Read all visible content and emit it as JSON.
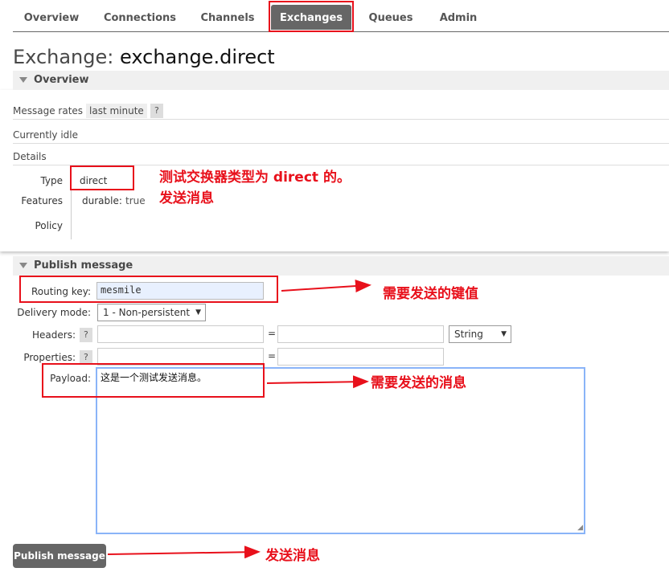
{
  "nav": {
    "items": [
      {
        "label": "Overview",
        "active": false
      },
      {
        "label": "Connections",
        "active": false
      },
      {
        "label": "Channels",
        "active": false
      },
      {
        "label": "Exchanges",
        "active": true
      },
      {
        "label": "Queues",
        "active": false
      },
      {
        "label": "Admin",
        "active": false
      }
    ]
  },
  "title": {
    "prefix": "Exchange:",
    "name": "exchange.direct"
  },
  "overview": {
    "heading": "Overview",
    "rates_label": "Message rates",
    "rates_value": "last minute",
    "help": "?",
    "idle": "Currently idle",
    "details_label": "Details",
    "type_key": "Type",
    "type_value": "direct",
    "features_key": "Features",
    "features_name": "durable:",
    "features_value": "true",
    "policy_key": "Policy"
  },
  "publish": {
    "heading": "Publish message",
    "routing_key_label": "Routing key:",
    "routing_key_value": "mesmile",
    "delivery_mode_label": "Delivery mode:",
    "delivery_mode_value": "1 - Non-persistent",
    "headers_label": "Headers:",
    "properties_label": "Properties:",
    "help": "?",
    "equals": "=",
    "header_type": "String",
    "payload_label": "Payload:",
    "payload_value": "这是一个测试发送消息。",
    "button_label": "Publish message"
  },
  "annotations": {
    "type_note_line1": "测试交换器类型为 direct 的。",
    "type_note_line2": "发送消息",
    "routing_note": "需要发送的键值",
    "payload_note": "需要发送的消息",
    "button_note": "发送消息",
    "color": "#e8101b"
  },
  "colors": {
    "active_tab": "#666666",
    "button": "#666666",
    "section_bg": "#f0f0f0"
  }
}
